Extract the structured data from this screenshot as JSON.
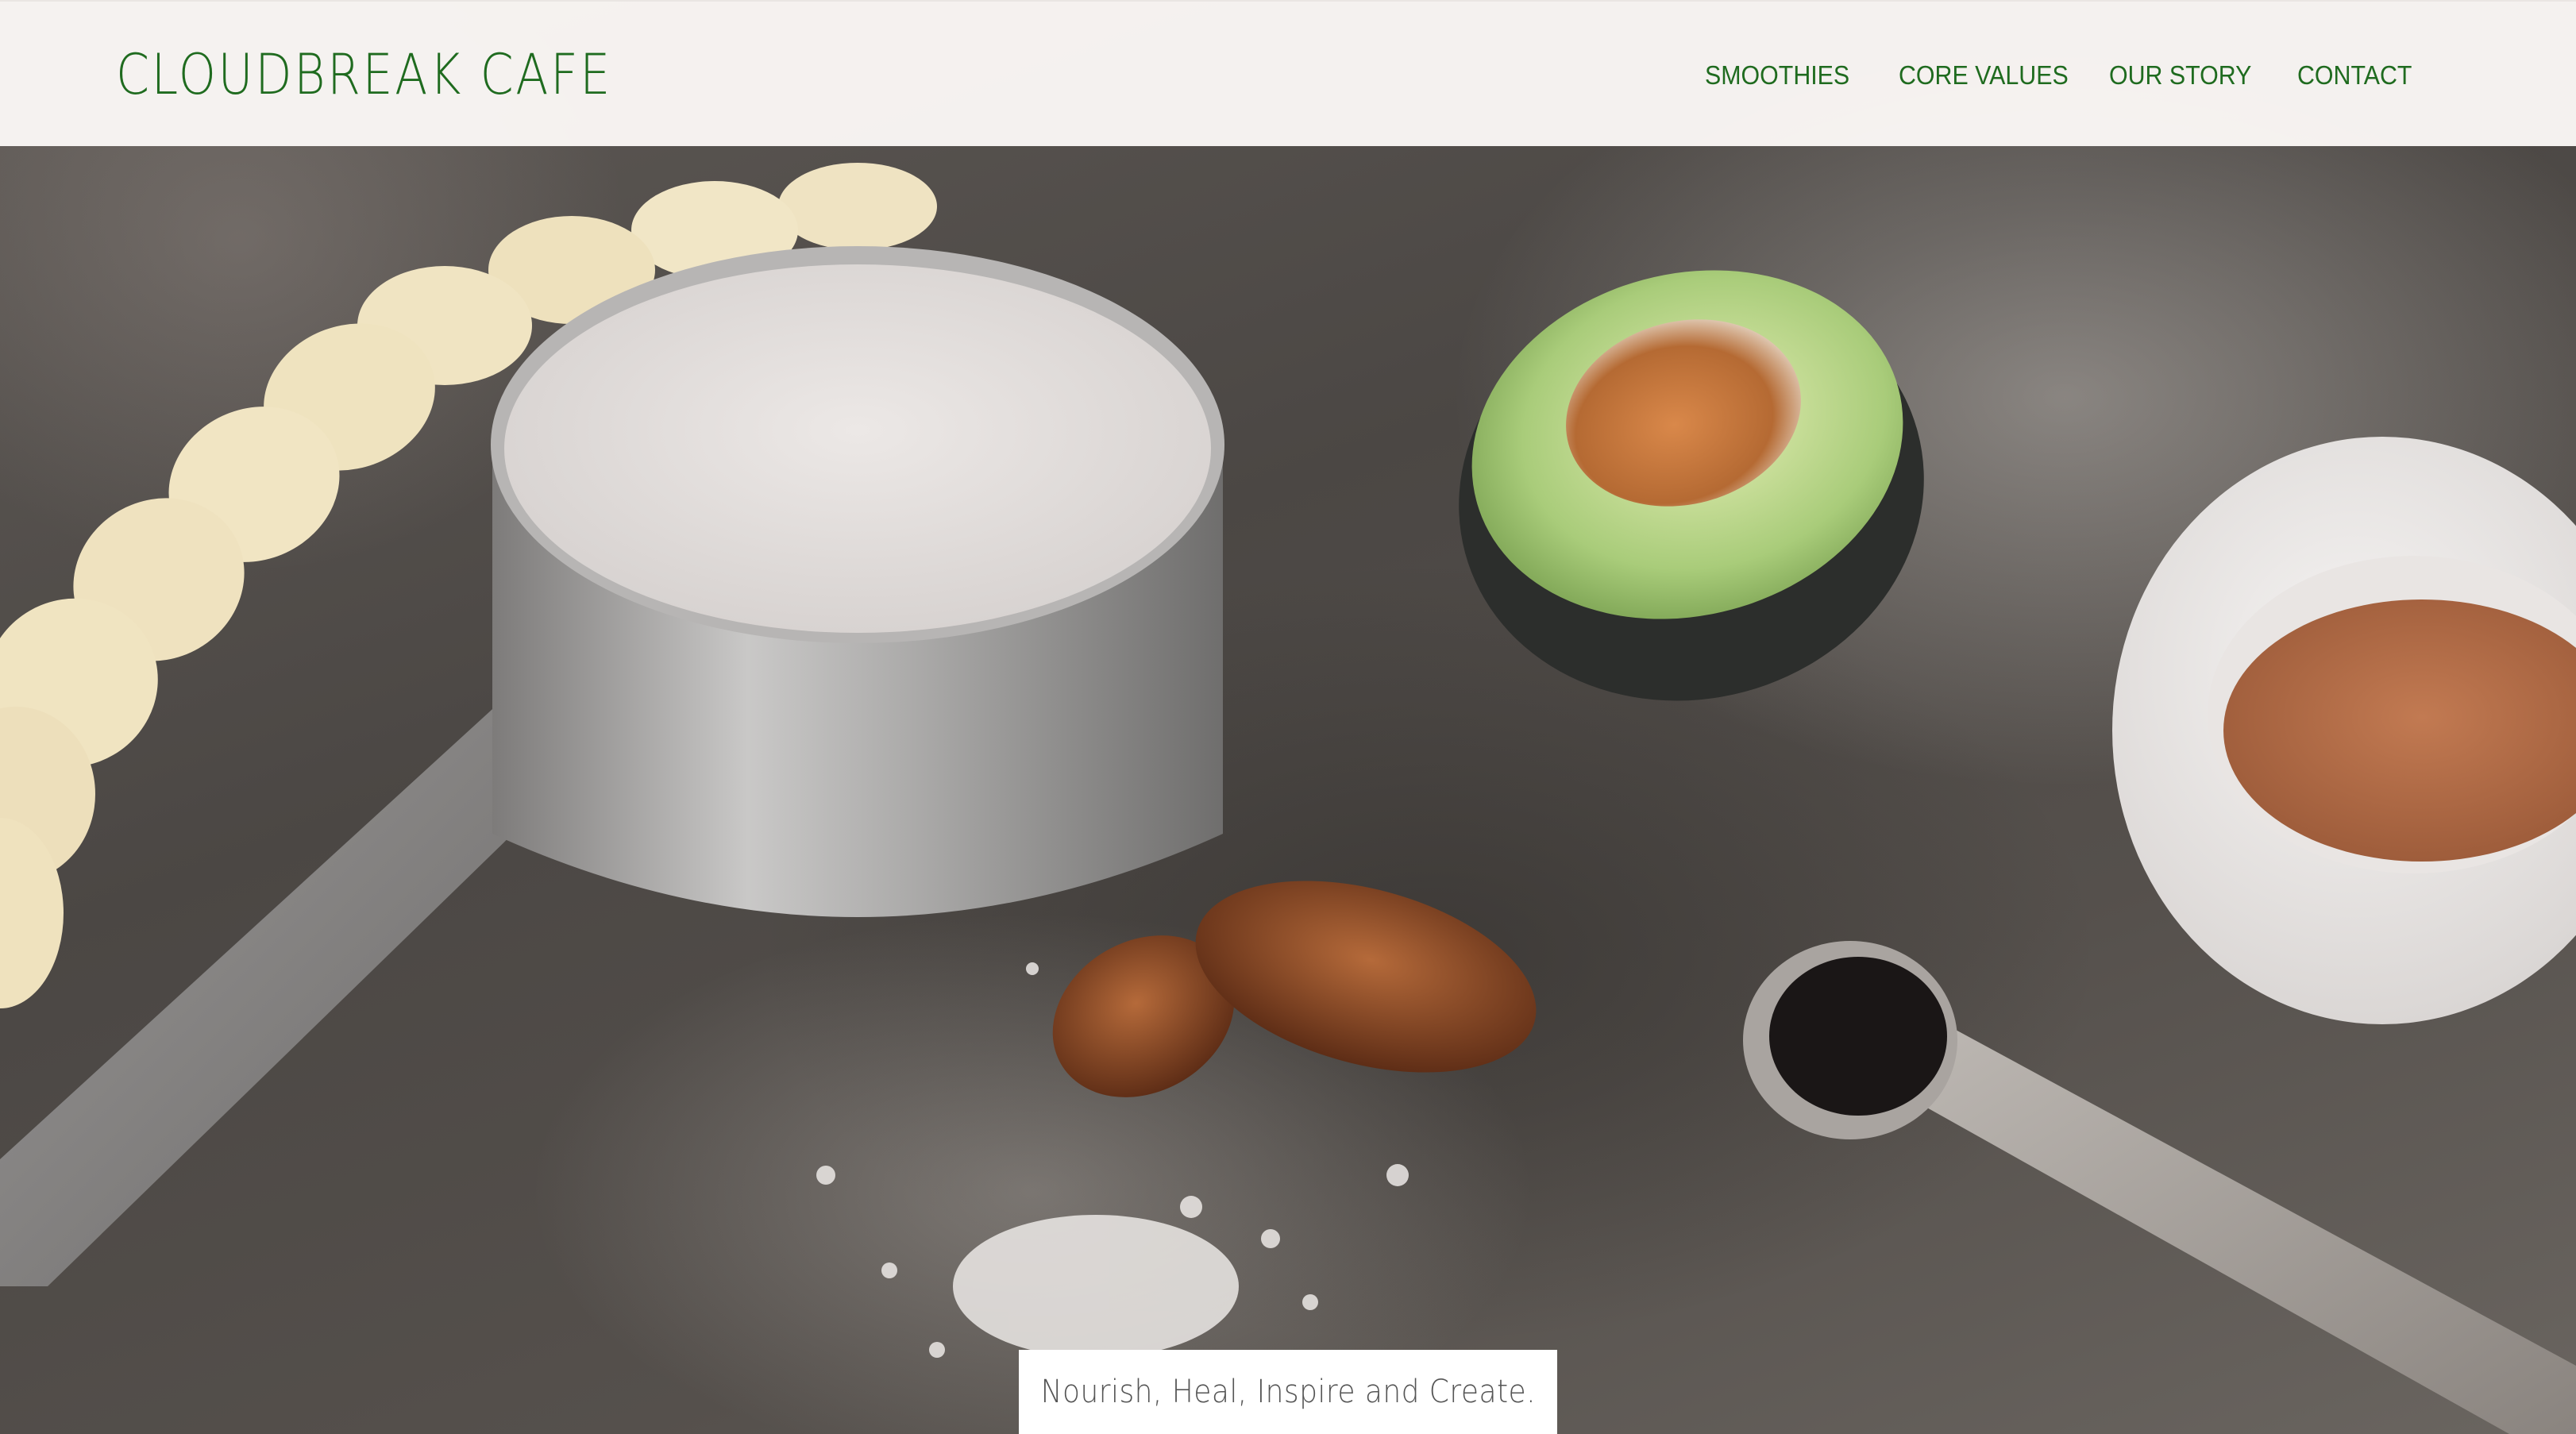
{
  "brand": {
    "name": "CLOUDBREAK CAFE"
  },
  "nav": {
    "items": [
      {
        "label": "SMOOTHIES"
      },
      {
        "label": "CORE VALUES"
      },
      {
        "label": "OUR STORY"
      },
      {
        "label": "CONTACT"
      }
    ]
  },
  "hero": {
    "tagline": "Nourish, Heal, Inspire and Create."
  },
  "colors": {
    "accent": "#1f6b1f",
    "header_bg": "#faf7f5",
    "tagline_bg": "#ffffff",
    "tagline_text": "#555555"
  }
}
